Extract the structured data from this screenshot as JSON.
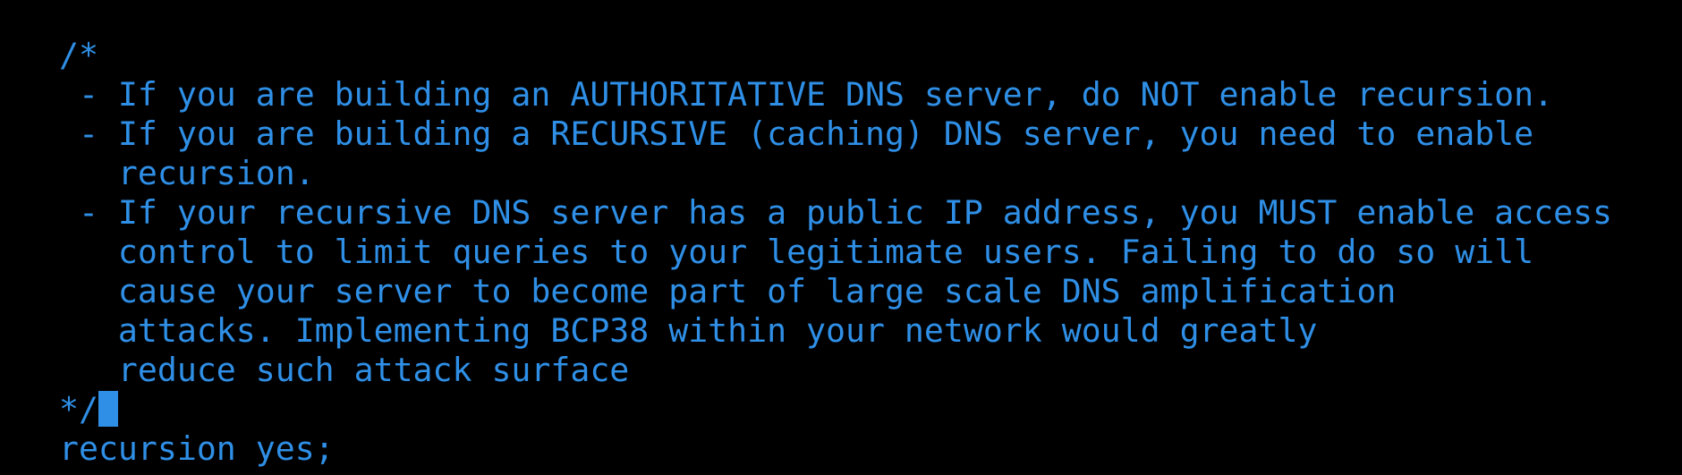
{
  "terminal": {
    "lines": [
      "/*",
      " - If you are building an AUTHORITATIVE DNS server, do NOT enable recursion.",
      " - If you are building a RECURSIVE (caching) DNS server, you need to enable",
      "   recursion.",
      " - If your recursive DNS server has a public IP address, you MUST enable access",
      "   control to limit queries to your legitimate users. Failing to do so will",
      "   cause your server to become part of large scale DNS amplification",
      "   attacks. Implementing BCP38 within your network would greatly",
      "   reduce such attack surface",
      "*/",
      "recursion yes;"
    ],
    "cursor_line": 9,
    "text_color": "#2f8fe6",
    "background_color": "#000000"
  }
}
